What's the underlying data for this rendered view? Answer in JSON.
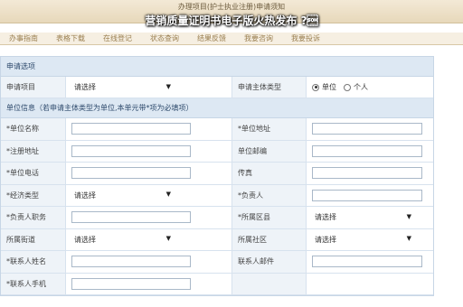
{
  "header": {
    "top_title": "办理项目(护士执业注册)申请须知",
    "overlay_title": "营销质量证明书电子版火热发布 ?\u0001",
    "tabs": [
      "办事指南",
      "表格下载",
      "在线登记",
      "状态查询",
      "结果反馈",
      "我要咨询",
      "我要投诉"
    ]
  },
  "section1": {
    "title": "申请选项",
    "project_label": "申请项目",
    "project_value": "请选择",
    "type_label": "申请主体类型",
    "options": [
      {
        "label": "单位",
        "checked": true
      },
      {
        "label": "个人",
        "checked": false
      }
    ]
  },
  "section2": {
    "title": "单位信息（若申请主体类型为单位,本单元带*项为必填项）",
    "rows": [
      {
        "l1": "*单位名称",
        "v1": "",
        "l2": "*单位地址",
        "v2": ""
      },
      {
        "l1": "*注册地址",
        "v1": "",
        "l2": "单位邮编",
        "v2": ""
      },
      {
        "l1": "*单位电话",
        "v1": "",
        "l2": "传真",
        "v2": ""
      },
      {
        "l1": "*经济类型",
        "v1": "请选择",
        "l2": "*负责人",
        "v2": ""
      },
      {
        "l1": "*负责人职务",
        "v1": "",
        "l2": "*所属区县",
        "v2": "请选择"
      },
      {
        "l1": "所属街道",
        "v1": "请选择",
        "l2": "所属社区",
        "v2": "请选择"
      },
      {
        "l1": "*联系人姓名",
        "v1": "",
        "l2": "联系人邮件",
        "v2": ""
      },
      {
        "l1": "*联系人手机",
        "v1": "",
        "l2": "",
        "v2": ""
      }
    ]
  }
}
